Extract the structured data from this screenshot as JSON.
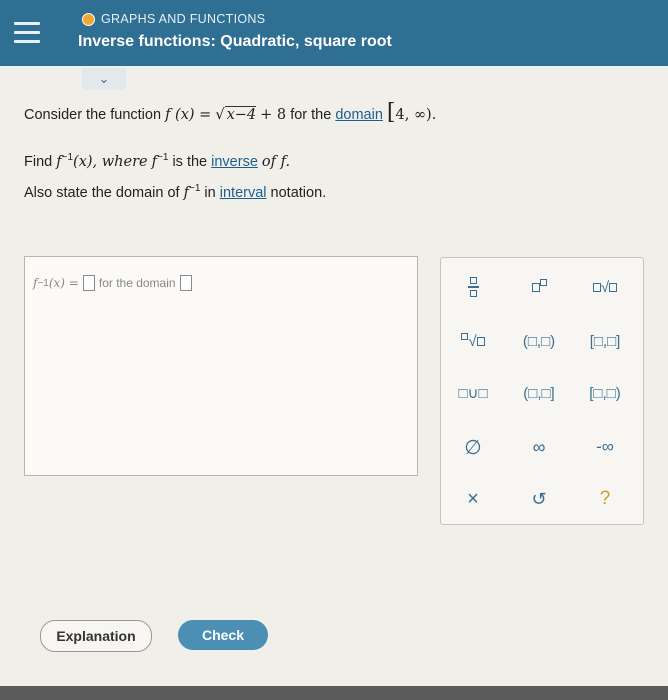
{
  "header": {
    "topic": "GRAPHS AND FUNCTIONS",
    "title": "Inverse functions: Quadratic, square root"
  },
  "problem": {
    "intro": "Consider the function",
    "fx": "f (x) =",
    "radicand": "x−4",
    "plus": "+ 8",
    "for_the": "for the",
    "domain_link": "domain",
    "domain_value": "4, ∞).",
    "find": "Find",
    "f_inv_x": "f",
    "inv_sup": "−1",
    "x_paren": "(x), where",
    "is_the": "is the",
    "inverse_link": "inverse",
    "of_f": "of f.",
    "also": "Also state the domain of",
    "in": "in",
    "interval_link": "interval",
    "notation": "notation."
  },
  "answer": {
    "lhs": "f",
    "lhs_sup": "−1",
    "lhs_x": "(x) =",
    "for_domain": "for the domain"
  },
  "keypad": {
    "open_closed": "(□,□)",
    "closed_closed": "[□,□]",
    "union": "□∪□",
    "open_left_closed": "(□,□]",
    "closed_open": "[□,□)",
    "empty_set": "∅",
    "infinity": "∞",
    "neg_infinity": "-∞",
    "clear": "×",
    "undo": "↺",
    "help": "?"
  },
  "buttons": {
    "explanation": "Explanation",
    "check": "Check"
  },
  "colors": {
    "header": "#2f6f93",
    "accent": "#3b6e91",
    "check_button": "#4c8fb5"
  }
}
